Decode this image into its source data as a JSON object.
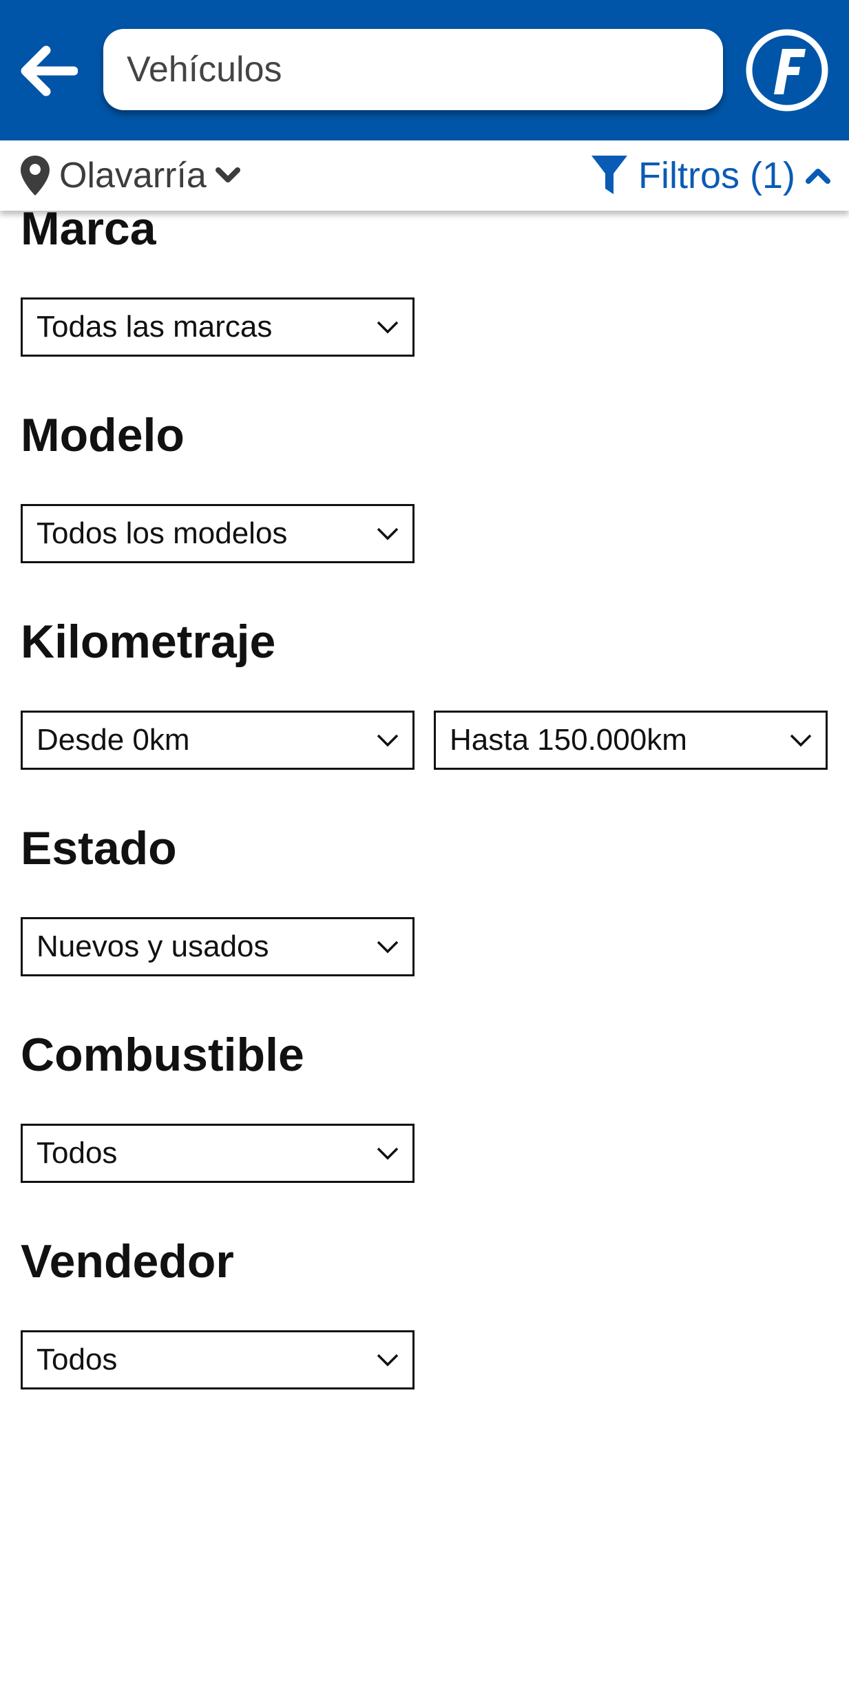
{
  "header": {
    "search_value": "Vehículos",
    "accent_color": "#0055a8"
  },
  "subbar": {
    "location": "Olavarría",
    "filters_label": "Filtros (1)",
    "filters_color": "#0a5bb5"
  },
  "filters": {
    "marca": {
      "title": "Marca",
      "value": "Todas las marcas"
    },
    "modelo": {
      "title": "Modelo",
      "value": "Todos los modelos"
    },
    "kilometraje": {
      "title": "Kilometraje",
      "from": "Desde 0km",
      "to": "Hasta 150.000km"
    },
    "estado": {
      "title": "Estado",
      "value": "Nuevos y usados"
    },
    "combustible": {
      "title": "Combustible",
      "value": "Todos"
    },
    "vendedor": {
      "title": "Vendedor",
      "value": "Todos"
    }
  }
}
